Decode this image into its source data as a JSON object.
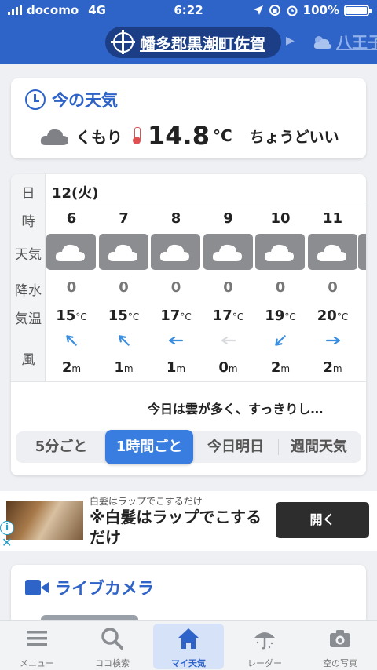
{
  "status": {
    "carrier": "docomo",
    "network": "4G",
    "time": "6:22",
    "battery": "100%"
  },
  "header": {
    "location": "幡多郡黒潮町佐賀",
    "next_location": "八王子"
  },
  "now": {
    "title": "今の天気",
    "condition": "くもり",
    "temp": "14.8",
    "unit": "°C",
    "feel": "ちょうどいい"
  },
  "hourly": {
    "labels": {
      "day": "日",
      "hour": "時",
      "weather": "天気",
      "precip": "降水",
      "temp": "気温",
      "wind": "風"
    },
    "day": "12(火)",
    "columns": [
      {
        "hour": "6",
        "weather": "cloudy",
        "precip": "0",
        "temp": "15",
        "wind": "2",
        "wind_dir": "NW"
      },
      {
        "hour": "7",
        "weather": "cloudy",
        "precip": "0",
        "temp": "15",
        "wind": "1",
        "wind_dir": "NW"
      },
      {
        "hour": "8",
        "weather": "cloudy",
        "precip": "0",
        "temp": "17",
        "wind": "1",
        "wind_dir": "W"
      },
      {
        "hour": "9",
        "weather": "cloudy",
        "precip": "0",
        "temp": "17",
        "wind": "0",
        "wind_dir": "calm"
      },
      {
        "hour": "10",
        "weather": "cloudy",
        "precip": "0",
        "temp": "19",
        "wind": "2",
        "wind_dir": "SW"
      },
      {
        "hour": "11",
        "weather": "cloudy",
        "precip": "0",
        "temp": "20",
        "wind": "2",
        "wind_dir": "E"
      }
    ],
    "temp_unit": "°C",
    "wind_unit": "m",
    "comment": "今日は雲が多く、すっきりし…",
    "tabs": [
      "5分ごと",
      "1時間ごと",
      "今日明日",
      "週間天気"
    ],
    "active_tab": "1時間ごと"
  },
  "ad": {
    "small": "白髪はラップでこするだけ",
    "title": "※白髪はラップでこするだけ",
    "button": "開く",
    "info": "i",
    "close": "✕"
  },
  "camera": {
    "title": "ライブカメラ"
  },
  "tabbar": [
    {
      "label": "メニュー",
      "icon": "menu-icon"
    },
    {
      "label": "ココ検索",
      "icon": "search-icon"
    },
    {
      "label": "マイ天気",
      "icon": "home-icon",
      "active": true
    },
    {
      "label": "レーダー",
      "icon": "radar-umbrella-icon"
    },
    {
      "label": "空の写真",
      "icon": "camera-icon"
    }
  ]
}
